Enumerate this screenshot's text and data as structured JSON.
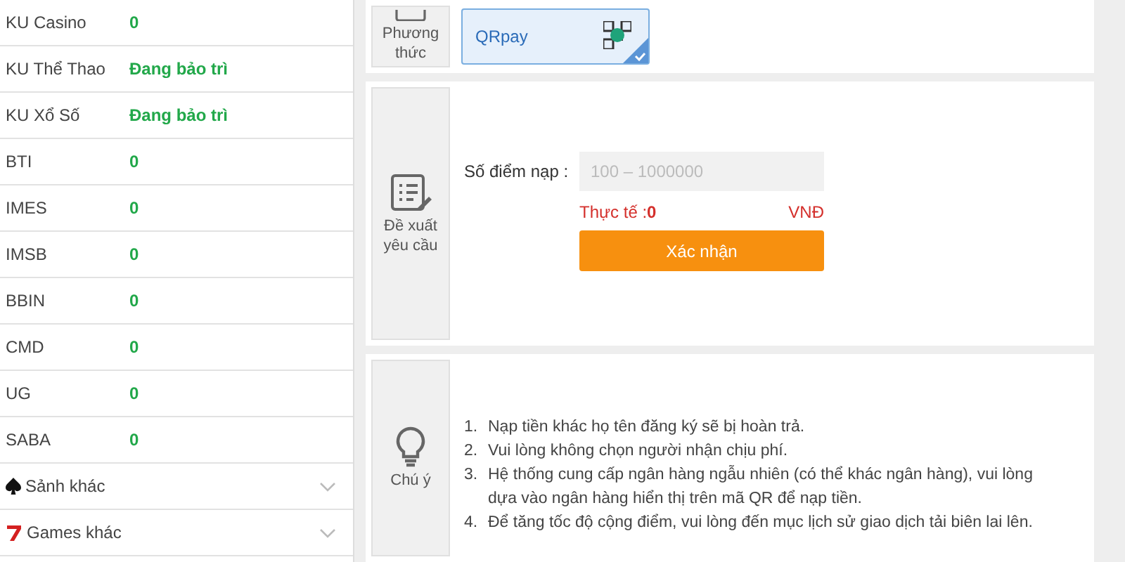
{
  "sidebar": {
    "rows": [
      {
        "kind": "balance",
        "name": "KU Casino",
        "value": "0"
      },
      {
        "kind": "balance",
        "name": "KU Thể Thao",
        "value": "Đang bảo trì"
      },
      {
        "kind": "balance",
        "name": "KU Xổ Số",
        "value": "Đang bảo trì"
      },
      {
        "kind": "balance",
        "name": "BTI",
        "value": "0"
      },
      {
        "kind": "balance",
        "name": "IMES",
        "value": "0"
      },
      {
        "kind": "balance",
        "name": "IMSB",
        "value": "0"
      },
      {
        "kind": "balance",
        "name": "BBIN",
        "value": "0"
      },
      {
        "kind": "balance",
        "name": "CMD",
        "value": "0"
      },
      {
        "kind": "balance",
        "name": "UG",
        "value": "0"
      },
      {
        "kind": "balance",
        "name": "SABA",
        "value": "0"
      },
      {
        "kind": "lobby",
        "name": "Sảnh khác"
      },
      {
        "kind": "games",
        "name": "Games khác"
      }
    ]
  },
  "method": {
    "label": "Phương thức",
    "options": [
      {
        "label": "QRpay",
        "selected": true
      }
    ]
  },
  "request": {
    "label": "Đề xuất yêu cầu",
    "field_label": "Số điểm nạp :",
    "placeholder": "100 – 1000000",
    "actual_label": "Thực tế :",
    "actual_value": "0",
    "currency": "VNĐ",
    "button": "Xác nhận"
  },
  "notes": {
    "label": "Chú ý",
    "items": [
      {
        "number": "1.",
        "text": "Nạp tiền khác họ tên đăng ký sẽ bị hoàn trả."
      },
      {
        "number": "2.",
        "text": "Vui lòng không chọn người nhận chịu phí."
      },
      {
        "number": "3.",
        "text": "Hệ thống cung cấp ngân hàng ngẫu nhiên (có thể khác ngân hàng), vui lòng dựa vào ngân hàng hiển thị trên mã QR để nạp tiền."
      },
      {
        "number": "4.",
        "text": "Để tăng tốc độ cộng điểm, vui lòng đến mục lịch sử giao dịch tải biên lai lên."
      }
    ]
  }
}
